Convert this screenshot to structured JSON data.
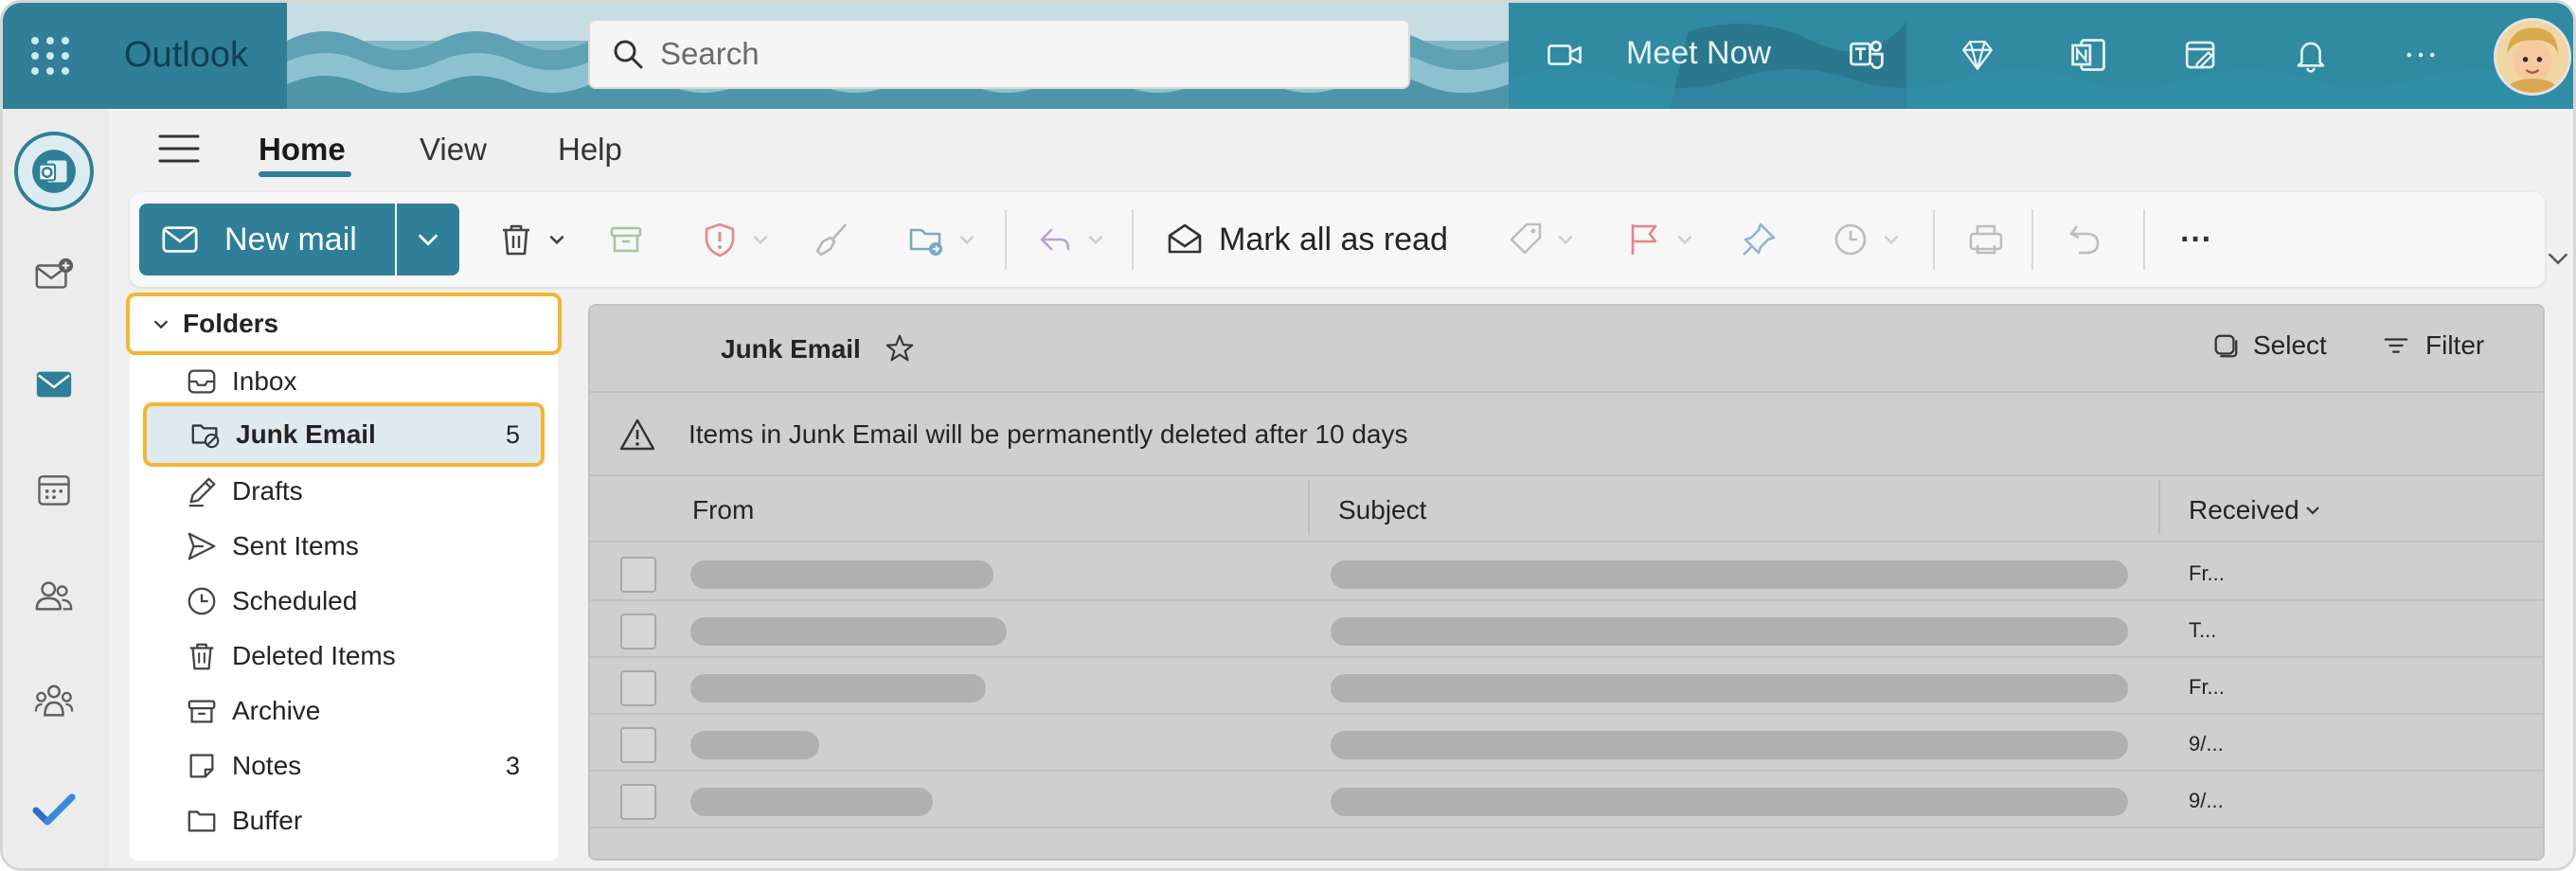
{
  "header": {
    "app_name": "Outlook",
    "search_placeholder": "Search",
    "meet_now_label": "Meet Now",
    "accent_color": "#2e7f97"
  },
  "ribbon": {
    "tabs": [
      {
        "label": "Home",
        "active": true
      },
      {
        "label": "View",
        "active": false
      },
      {
        "label": "Help",
        "active": false
      }
    ]
  },
  "toolbar": {
    "new_mail_label": "New mail",
    "mark_all_read_label": "Mark all as read",
    "more_label": "···"
  },
  "folders": {
    "header_label": "Folders",
    "items": [
      {
        "label": "Inbox",
        "icon": "inbox-icon",
        "count": ""
      },
      {
        "label": "Junk Email",
        "icon": "junk-icon",
        "count": "5",
        "selected": true
      },
      {
        "label": "Drafts",
        "icon": "drafts-icon",
        "count": ""
      },
      {
        "label": "Sent Items",
        "icon": "send-icon",
        "count": ""
      },
      {
        "label": "Scheduled",
        "icon": "clock-icon",
        "count": ""
      },
      {
        "label": "Deleted Items",
        "icon": "trash-icon",
        "count": ""
      },
      {
        "label": "Archive",
        "icon": "archive-icon",
        "count": ""
      },
      {
        "label": "Notes",
        "icon": "note-icon",
        "count": "3"
      },
      {
        "label": "Buffer",
        "icon": "folder-icon",
        "count": ""
      }
    ]
  },
  "message_list": {
    "title": "Junk Email",
    "select_label": "Select",
    "filter_label": "Filter",
    "banner_text": "Items in Junk Email will be permanently deleted after 10 days",
    "columns": {
      "from": "From",
      "subject": "Subject",
      "received": "Received"
    },
    "rows": [
      {
        "received": "Fr..."
      },
      {
        "received": "T..."
      },
      {
        "received": "Fr..."
      },
      {
        "received": "9/..."
      },
      {
        "received": "9/..."
      }
    ]
  },
  "highlight_color": "#f5b533"
}
